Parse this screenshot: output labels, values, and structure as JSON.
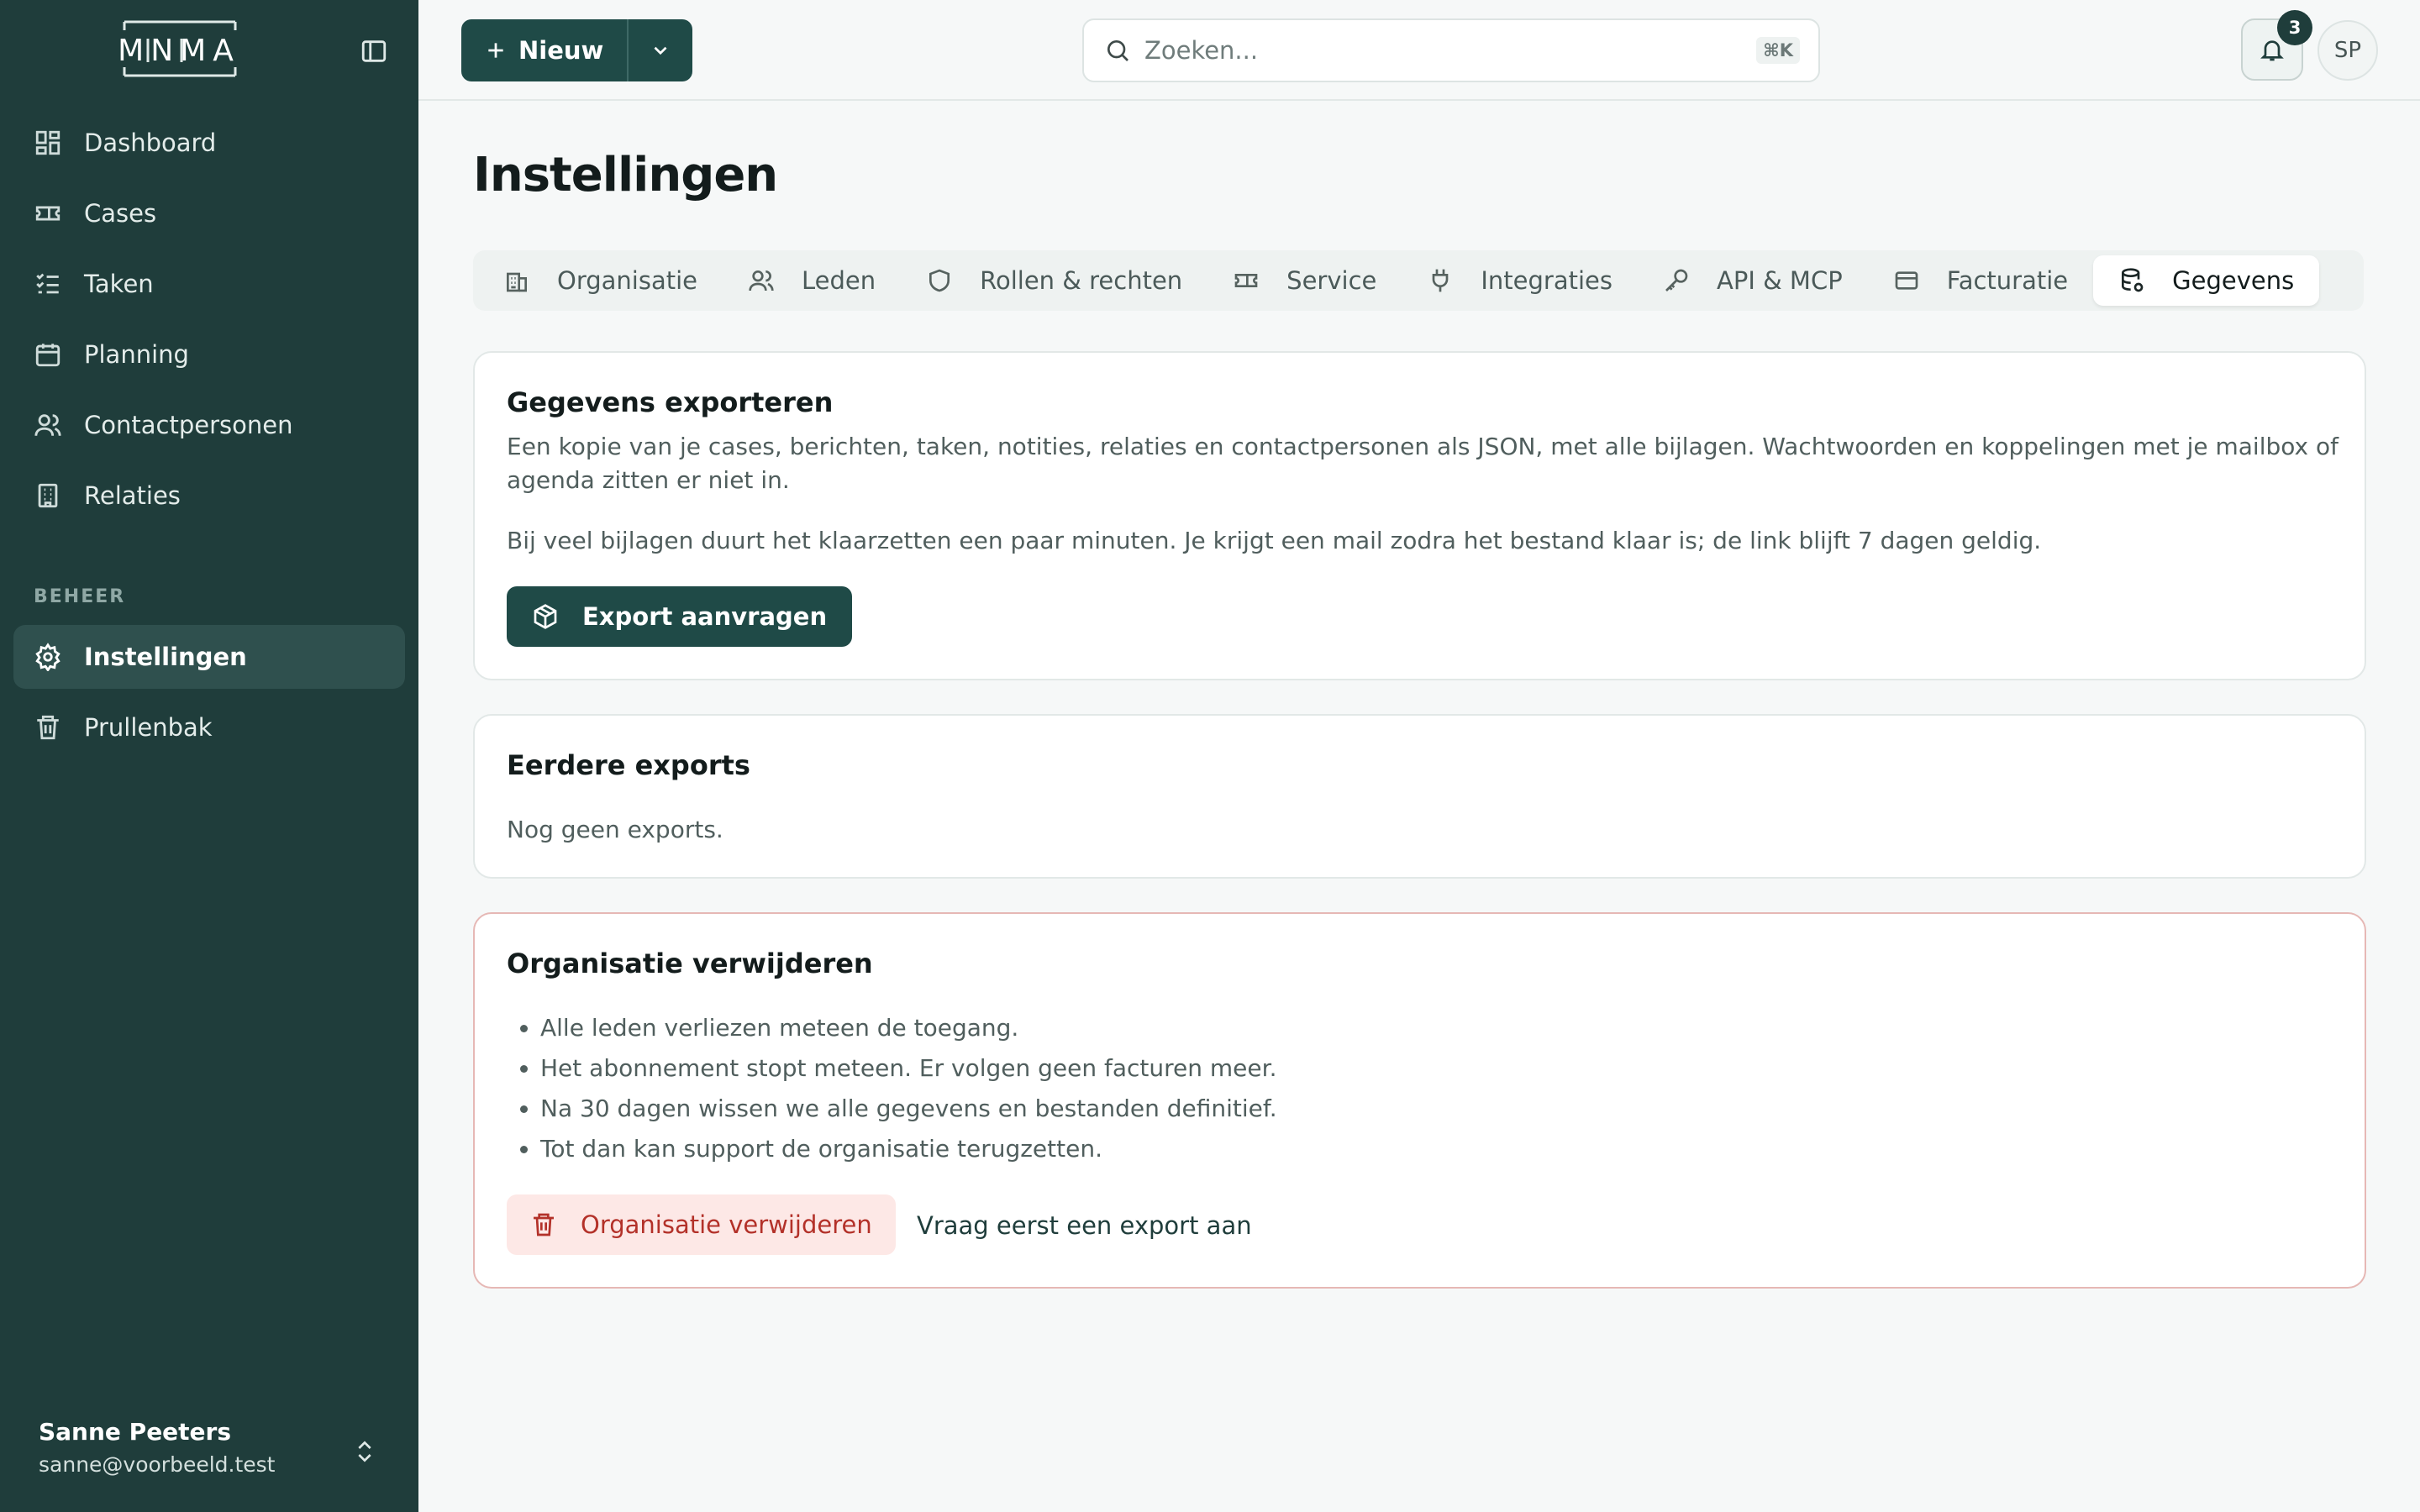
{
  "app": {
    "logo_text": "MNMA"
  },
  "sidebar": {
    "nav": [
      {
        "label": "Dashboard",
        "icon": "dashboard-icon"
      },
      {
        "label": "Cases",
        "icon": "ticket-icon"
      },
      {
        "label": "Taken",
        "icon": "list-check-icon"
      },
      {
        "label": "Planning",
        "icon": "calendar-icon"
      },
      {
        "label": "Contactpersonen",
        "icon": "users-icon"
      },
      {
        "label": "Relaties",
        "icon": "building-icon"
      }
    ],
    "section_label": "BEHEER",
    "admin": [
      {
        "label": "Instellingen",
        "icon": "gear-icon",
        "active": true
      },
      {
        "label": "Prullenbak",
        "icon": "trash-icon"
      }
    ],
    "user": {
      "name": "Sanne Peeters",
      "email": "sanne@voorbeeld.test"
    }
  },
  "topbar": {
    "new_label": "Nieuw",
    "search_placeholder": "Zoeken...",
    "search_shortcut": "⌘K",
    "notifications_count": "3",
    "avatar_initials": "SP"
  },
  "page": {
    "title": "Instellingen",
    "tabs": [
      {
        "label": "Organisatie",
        "icon": "building-icon"
      },
      {
        "label": "Leden",
        "icon": "users-icon"
      },
      {
        "label": "Rollen & rechten",
        "icon": "shield-icon"
      },
      {
        "label": "Service",
        "icon": "ticket-icon"
      },
      {
        "label": "Integraties",
        "icon": "plug-icon"
      },
      {
        "label": "API & MCP",
        "icon": "key-icon"
      },
      {
        "label": "Facturatie",
        "icon": "credit-card-icon"
      },
      {
        "label": "Gegevens",
        "icon": "database-icon",
        "active": true
      }
    ]
  },
  "export_card": {
    "title": "Gegevens exporteren",
    "description": "Een kopie van je cases, berichten, taken, notities, relaties en contactpersonen als JSON, met alle bijlagen. Wachtwoorden en koppelingen met je mailbox of agenda zitten er niet in.",
    "note": "Bij veel bijlagen duurt het klaarzetten een paar minuten. Je krijgt een mail zodra het bestand klaar is; de link blijft 7 dagen geldig.",
    "button_label": "Export aanvragen"
  },
  "previous_exports": {
    "title": "Eerdere exports",
    "empty_text": "Nog geen exports."
  },
  "delete_card": {
    "title": "Organisatie verwijderen",
    "bullets": [
      "Alle leden verliezen meteen de toegang.",
      "Het abonnement stopt meteen. Er volgen geen facturen meer.",
      "Na 30 dagen wissen we alle gegevens en bestanden definitief.",
      "Tot dan kan support de organisatie terugzetten."
    ],
    "button_label": "Organisatie verwijderen",
    "hint_link": "Vraag eerst een export aan"
  },
  "colors": {
    "sidebar_bg": "#1f3d3b",
    "primary": "#1f4a47",
    "danger": "#b33129",
    "danger_bg": "#fde8e6"
  }
}
